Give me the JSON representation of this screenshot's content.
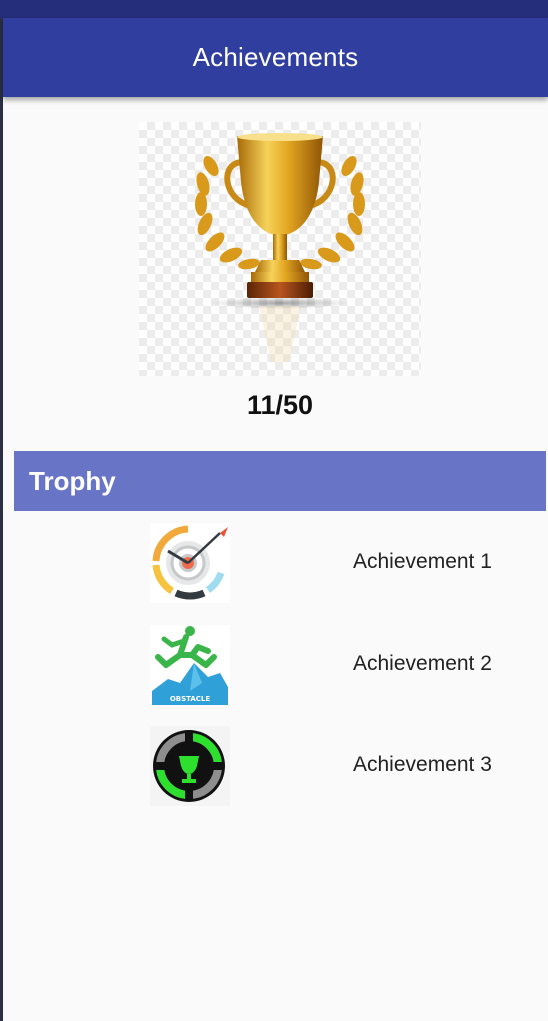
{
  "app": {
    "title": "Achievements"
  },
  "summary": {
    "progress_text": "11/50",
    "trophy_icon": "gold-trophy-icon"
  },
  "section": {
    "title": "Trophy"
  },
  "achievements": [
    {
      "label": "Achievement 1",
      "icon": "target-clock-icon"
    },
    {
      "label": "Achievement 2",
      "icon": "obstacle-jump-icon"
    },
    {
      "label": "Achievement 3",
      "icon": "green-trophy-badge-icon"
    }
  ],
  "colors": {
    "status_bar": "#252e7b",
    "app_bar": "#303f9f",
    "section_header": "#6874c5",
    "background": "#fafafa"
  }
}
